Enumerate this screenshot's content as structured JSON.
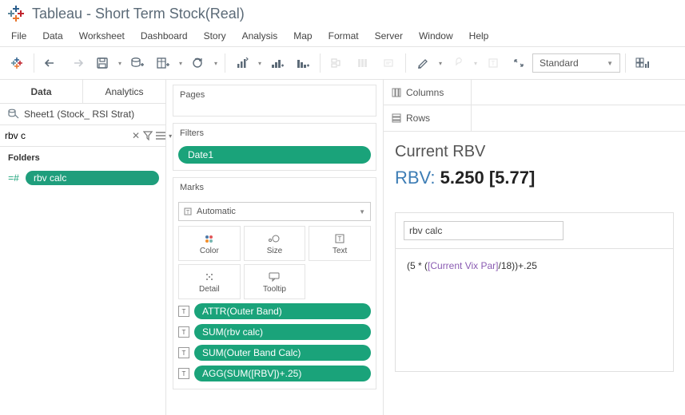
{
  "app": {
    "title": "Tableau - Short Term Stock(Real)"
  },
  "menu": [
    "File",
    "Data",
    "Worksheet",
    "Dashboard",
    "Story",
    "Analysis",
    "Map",
    "Format",
    "Server",
    "Window",
    "Help"
  ],
  "toolbar": {
    "standard_label": "Standard"
  },
  "left": {
    "tabs": {
      "data": "Data",
      "analytics": "Analytics"
    },
    "datasource": "Sheet1 (Stock_ RSI Strat)",
    "search_value": "rbv c",
    "folders_label": "Folders",
    "dim_pill": "rbv calc"
  },
  "mid": {
    "pages_label": "Pages",
    "filters_label": "Filters",
    "filter_pill": "Date1",
    "marks_label": "Marks",
    "marks_type": "Automatic",
    "cells": {
      "color": "Color",
      "size": "Size",
      "text": "Text",
      "detail": "Detail",
      "tooltip": "Tooltip"
    },
    "text_pills": [
      "ATTR(Outer Band)",
      "SUM(rbv calc)",
      "SUM(Outer Band Calc)",
      "AGG(SUM([RBV])+.25)"
    ]
  },
  "right": {
    "columns_label": "Columns",
    "rows_label": "Rows",
    "view_title": "Current RBV",
    "rbv_label": "RBV:",
    "rbv_value": "5.250",
    "rbv_bracket": "[5.77]",
    "calc_name": "rbv calc",
    "formula_prefix": "(5 * (",
    "formula_param": "[Current Vix Par]",
    "formula_suffix": "/18))+.25"
  }
}
